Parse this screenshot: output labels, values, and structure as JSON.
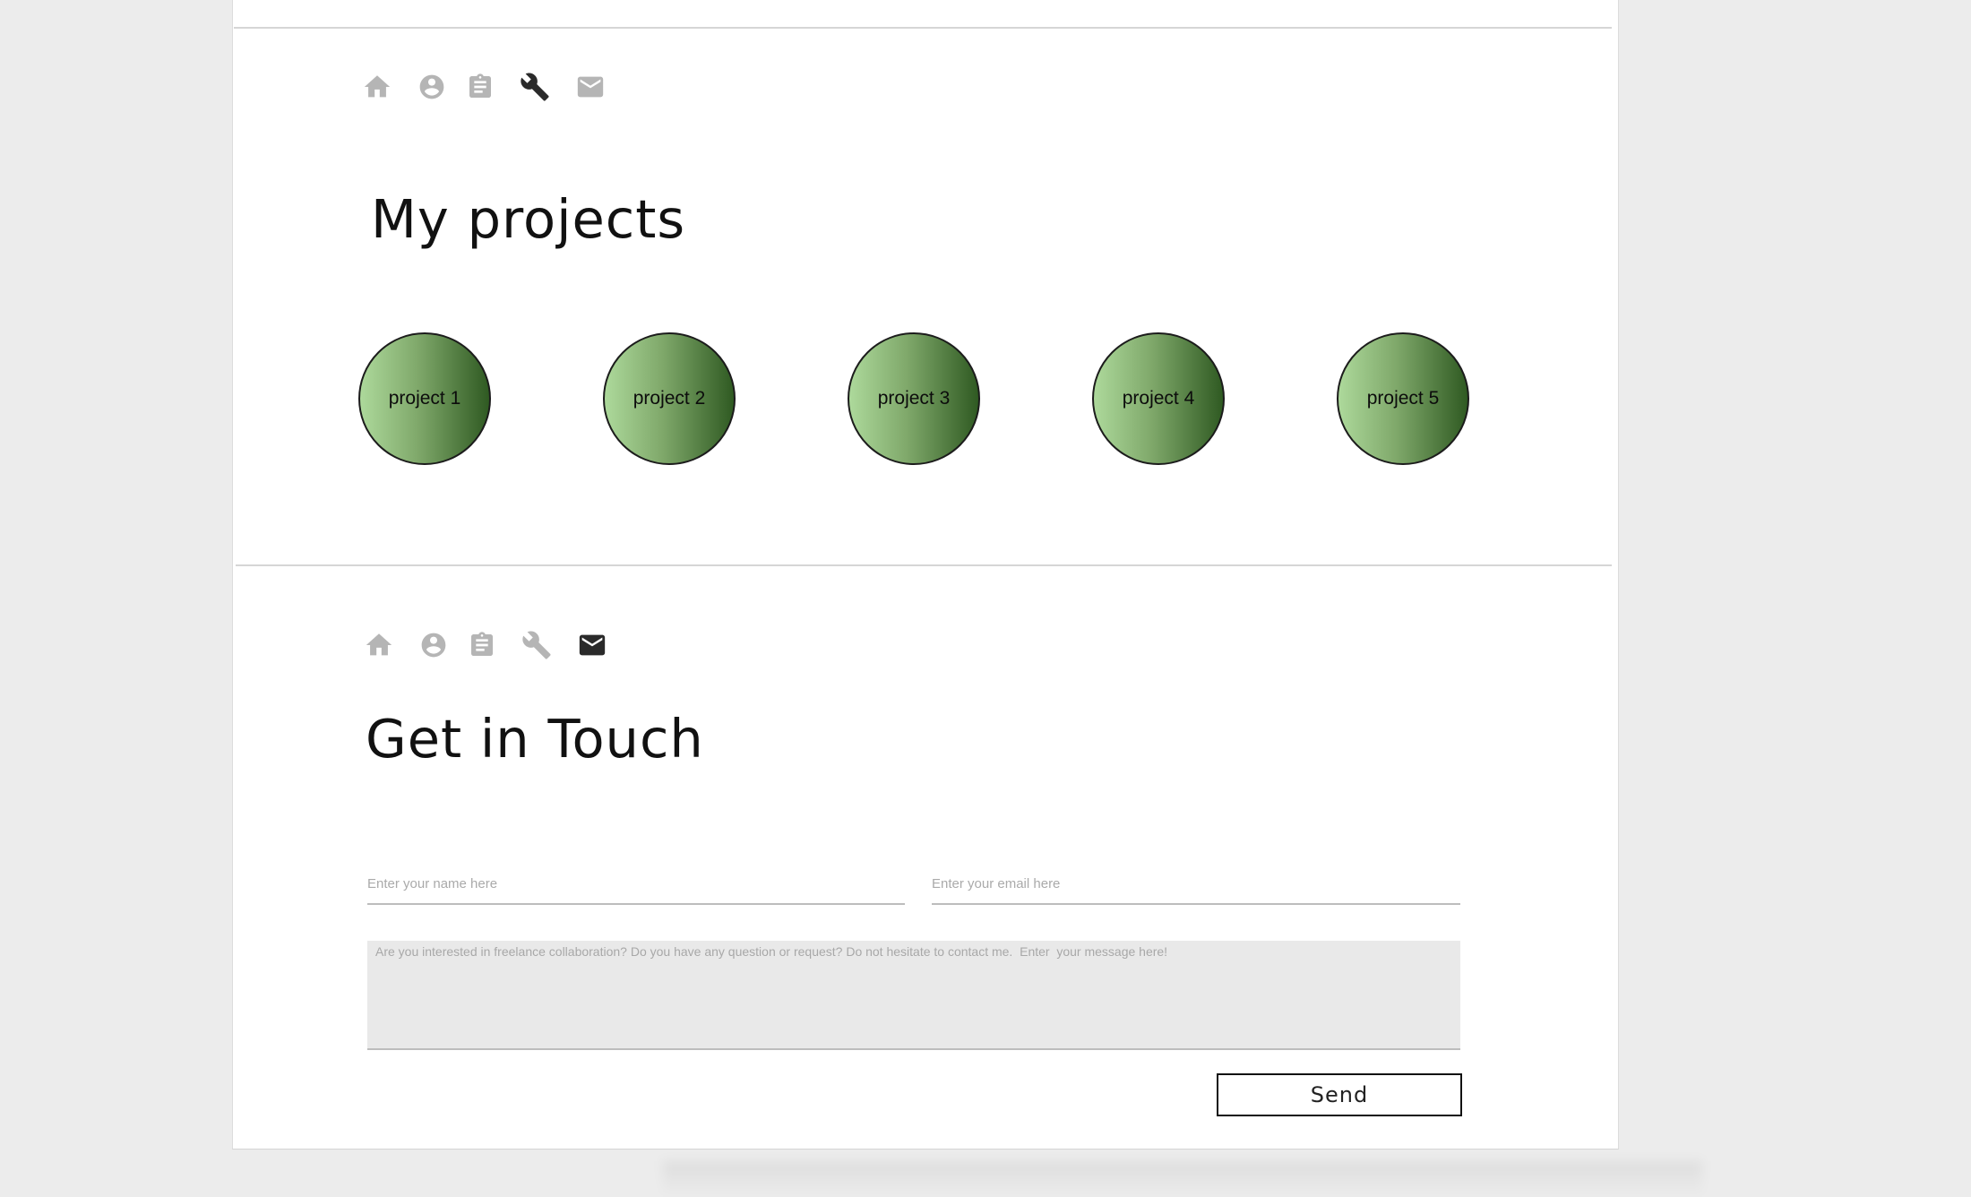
{
  "projects_section": {
    "nav": [
      {
        "icon": "home-icon",
        "active": false
      },
      {
        "icon": "user-icon",
        "active": false
      },
      {
        "icon": "clipboard-icon",
        "active": false
      },
      {
        "icon": "wrench-icon",
        "active": true
      },
      {
        "icon": "mail-icon",
        "active": false
      }
    ],
    "title": "My projects",
    "projects": [
      {
        "label": "project 1"
      },
      {
        "label": "project 2"
      },
      {
        "label": "project 3"
      },
      {
        "label": "project 4"
      },
      {
        "label": "project 5"
      }
    ]
  },
  "contact_section": {
    "nav": [
      {
        "icon": "home-icon",
        "active": false
      },
      {
        "icon": "user-icon",
        "active": false
      },
      {
        "icon": "clipboard-icon",
        "active": false
      },
      {
        "icon": "wrench-icon",
        "active": false
      },
      {
        "icon": "mail-icon",
        "active": true
      }
    ],
    "title": "Get in Touch",
    "name_placeholder": "Enter your name here",
    "email_placeholder": "Enter your email here",
    "message_placeholder": "Are you interested in freelance collaboration? Do you have any question or request? Do not hesitate to contact me.  Enter  your message here!",
    "send_label": "Send"
  },
  "colors": {
    "icon_inactive": "#b5b5b5",
    "icon_active": "#2a2a2a",
    "circle_light": "#add99b",
    "circle_dark": "#2f5a22"
  }
}
